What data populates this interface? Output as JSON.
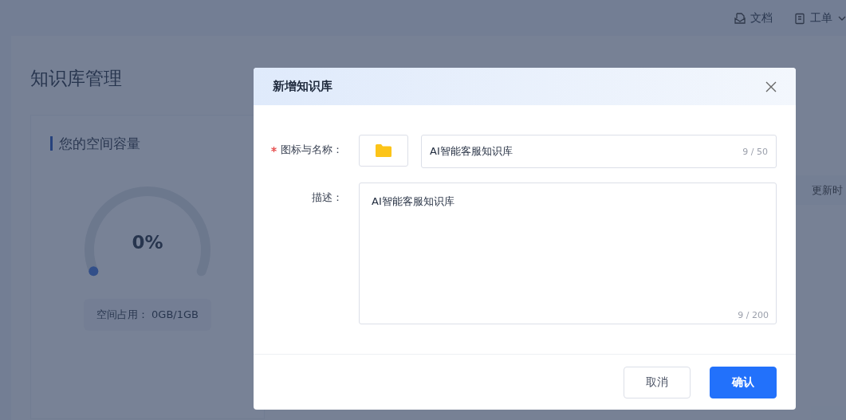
{
  "header_links": [
    {
      "kind": "docs",
      "label": "文档"
    },
    {
      "kind": "ticket",
      "label": "工单"
    }
  ],
  "page": {
    "title": "知识库管理",
    "storage_card": {
      "title": "您的空间容量",
      "percent": "0%",
      "level": 0,
      "usage": "空间占用： 0GB/1GB"
    },
    "table": {
      "column_header": "更新时"
    }
  },
  "dialog": {
    "title": "新增知识库",
    "fields": [
      {
        "kind": "icon_name",
        "label": "图标与名称：",
        "required": true,
        "value": "AI智能客服知识库",
        "counter": "9 / 50"
      },
      {
        "kind": "textarea",
        "label": "描述：",
        "required": false,
        "value": "AI智能客服知识库",
        "counter": "9 / 200"
      }
    ],
    "buttons": [
      {
        "label": "取消",
        "primary": false
      },
      {
        "label": "确认",
        "primary": true
      }
    ]
  }
}
